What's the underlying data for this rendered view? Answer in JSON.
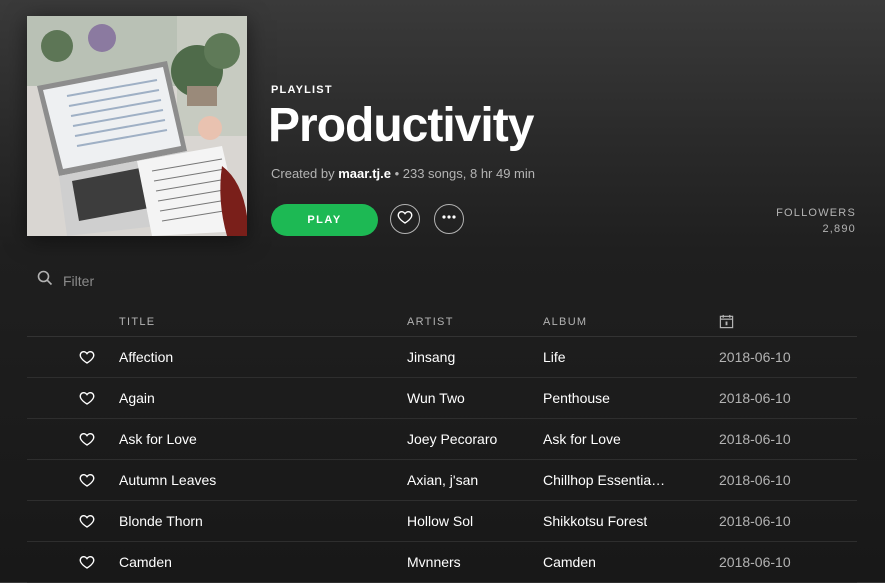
{
  "playlist": {
    "type_label": "PLAYLIST",
    "title": "Productivity",
    "created_by_prefix": "Created by",
    "owner": "maar.tj.e",
    "stats": " • 233 songs, 8 hr 49 min",
    "play_label": "PLAY",
    "followers_label": "FOLLOWERS",
    "followers_count": "2,890"
  },
  "filter": {
    "placeholder": "Filter"
  },
  "table": {
    "headers": {
      "title": "TITLE",
      "artist": "ARTIST",
      "album": "ALBUM",
      "date_icon": "calendar-icon"
    },
    "rows": [
      {
        "title": "Affection",
        "artist": "Jinsang",
        "album": "Life",
        "date": "2018-06-10"
      },
      {
        "title": "Again",
        "artist": "Wun Two",
        "album": "Penthouse",
        "date": "2018-06-10"
      },
      {
        "title": "Ask for Love",
        "artist": "Joey Pecoraro",
        "album": "Ask for Love",
        "date": "2018-06-10"
      },
      {
        "title": "Autumn Leaves",
        "artist": "Axian, j'san",
        "album": "Chillhop Essentia…",
        "date": "2018-06-10"
      },
      {
        "title": "Blonde Thorn",
        "artist": "Hollow Sol",
        "album": "Shikkotsu Forest",
        "date": "2018-06-10"
      },
      {
        "title": "Camden",
        "artist": "Mvnners",
        "album": "Camden",
        "date": "2018-06-10"
      }
    ]
  },
  "colors": {
    "accent": "#1db954",
    "muted": "#b3b3b3"
  }
}
